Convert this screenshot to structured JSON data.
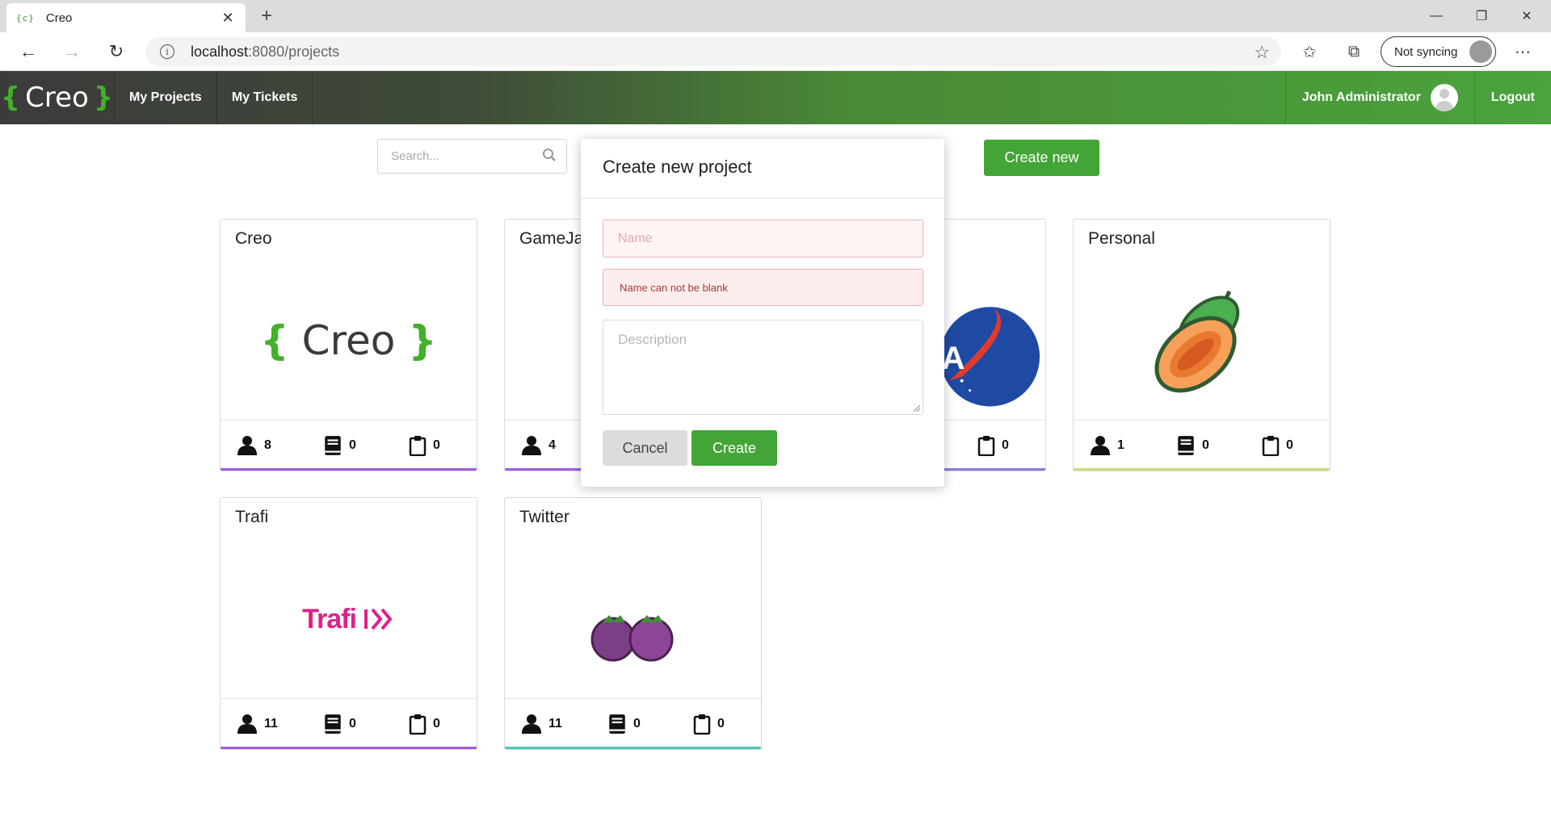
{
  "browser": {
    "tab_favicon": "{c}",
    "tab_title": "Creo",
    "url_host": "localhost",
    "url_path": ":8080/projects",
    "sync_label": "Not syncing"
  },
  "navbar": {
    "brand_open": "{",
    "brand_text": "Creo",
    "brand_close": "}",
    "links": [
      "My Projects",
      "My Tickets"
    ],
    "user_name": "John Administrator",
    "logout": "Logout"
  },
  "toolbar": {
    "search_placeholder": "Search...",
    "create_new": "Create new"
  },
  "projects": [
    {
      "title": "Creo",
      "logo_text": "Creo",
      "members": "8",
      "docs": "0",
      "tickets": "0",
      "accent": "#a15ce0"
    },
    {
      "title": "GameJa",
      "members": "4",
      "accent": "#a15ce0"
    },
    {
      "title": "",
      "tickets": "0",
      "accent": "#8b7ad9"
    },
    {
      "title": "Personal",
      "members": "1",
      "docs": "0",
      "tickets": "0",
      "accent": "#cfdb7a"
    },
    {
      "title": "Trafi",
      "logo_text": "Trafi",
      "members": "11",
      "docs": "0",
      "tickets": "0",
      "accent": "#a15ce0"
    },
    {
      "title": "Twitter",
      "members": "11",
      "docs": "0",
      "tickets": "0",
      "accent": "#4cc7b8"
    }
  ],
  "modal": {
    "title": "Create new project",
    "name_placeholder": "Name",
    "error": "Name can not be blank",
    "description_placeholder": "Description",
    "cancel": "Cancel",
    "create": "Create"
  }
}
